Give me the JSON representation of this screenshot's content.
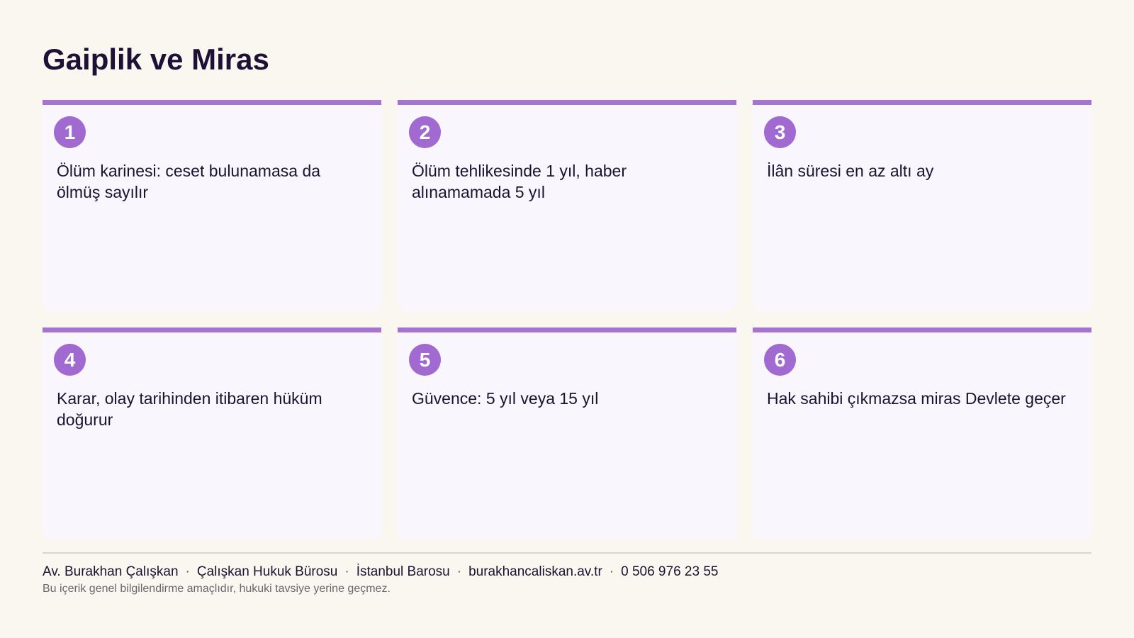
{
  "title": "Gaiplik ve Miras",
  "accent_color": "#a574d1",
  "cards": [
    {
      "number": "1",
      "text": "Ölüm karinesi: ceset bulunamasa da ölmüş sayılır"
    },
    {
      "number": "2",
      "text": "Ölüm tehlikesinde 1 yıl, haber alınamamada 5 yıl"
    },
    {
      "number": "3",
      "text": "İlân süresi en az altı ay"
    },
    {
      "number": "4",
      "text": "Karar, olay tarihinden itibaren hüküm doğurur"
    },
    {
      "number": "5",
      "text": "Güvence: 5 yıl veya 15 yıl"
    },
    {
      "number": "6",
      "text": "Hak sahibi çıkmazsa miras Devlete geçer"
    }
  ],
  "footer": {
    "separator": "·",
    "name": "Av. Burakhan Çalışkan",
    "firm": "Çalışkan Hukuk Bürosu",
    "bar": "İstanbul Barosu",
    "website": "burakhancaliskan.av.tr",
    "phone": "0 506 976 23 55",
    "disclaimer": "Bu içerik genel bilgilendirme amaçlıdır, hukuki tavsiye yerine geçmez."
  }
}
